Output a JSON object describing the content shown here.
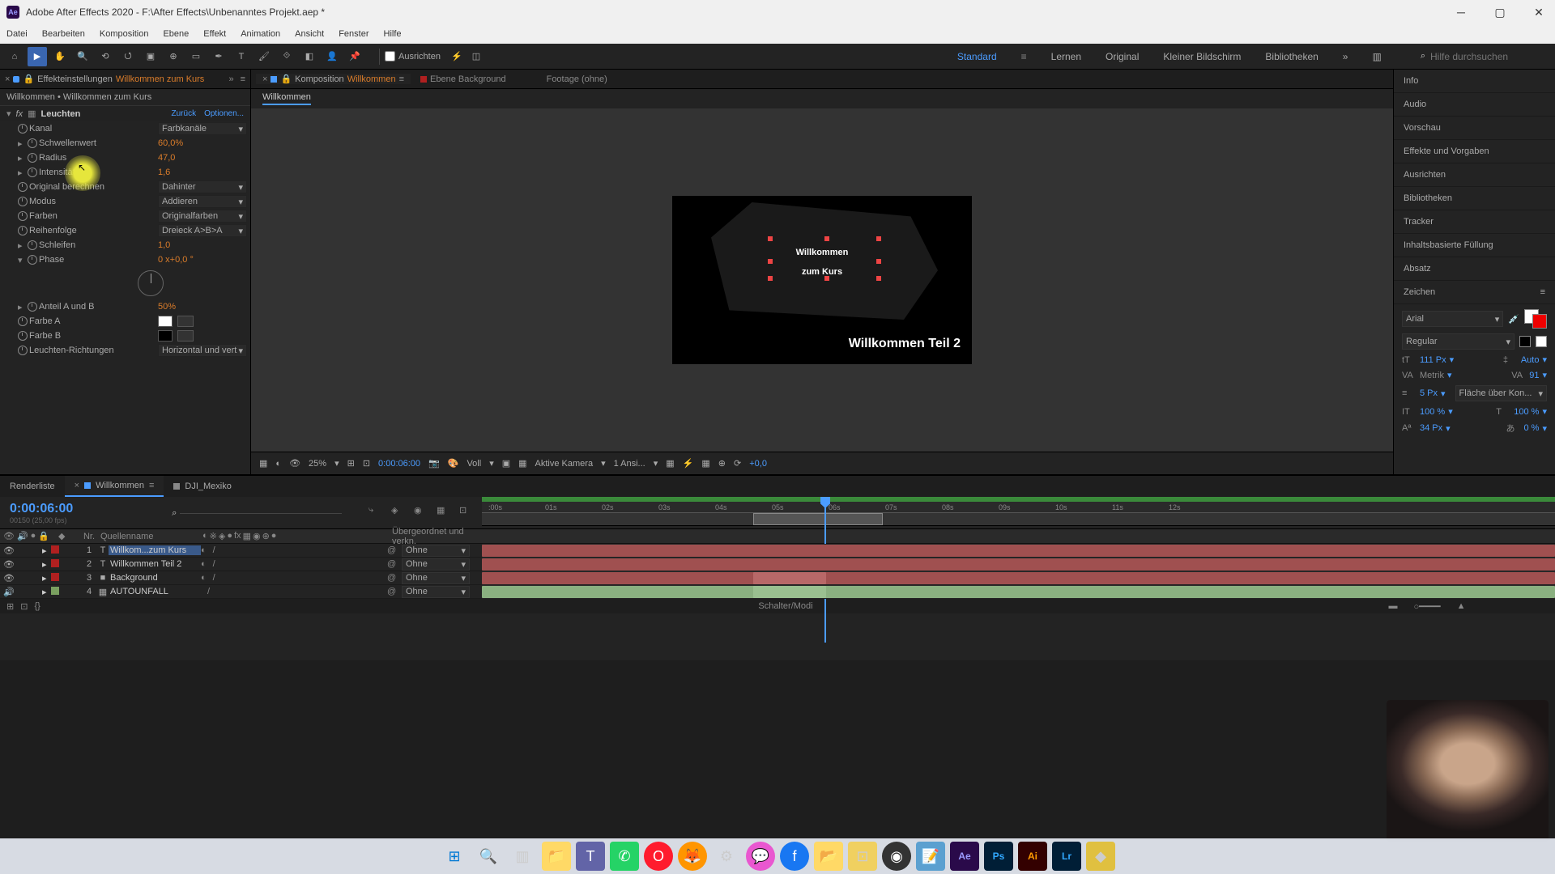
{
  "window": {
    "title": "Adobe After Effects 2020 - F:\\After Effects\\Unbenanntes Projekt.aep *",
    "app_badge": "Ae"
  },
  "menu": [
    "Datei",
    "Bearbeiten",
    "Komposition",
    "Ebene",
    "Effekt",
    "Animation",
    "Ansicht",
    "Fenster",
    "Hilfe"
  ],
  "toolbar": {
    "ausrichten_label": "Ausrichten",
    "search_placeholder": "Hilfe durchsuchen"
  },
  "workspaces": [
    "Standard",
    "Lernen",
    "Original",
    "Kleiner Bildschirm",
    "Bibliotheken"
  ],
  "effect_panel": {
    "tab_label": "Effekteinstellungen",
    "tab_target": "Willkommen zum Kurs",
    "breadcrumb": "Willkommen • Willkommen zum Kurs",
    "effect_name": "Leuchten",
    "reset_link": "Zurück",
    "options_link": "Optionen...",
    "props": {
      "kanal": {
        "label": "Kanal",
        "value": "Farbkanäle"
      },
      "schwellenwert": {
        "label": "Schwellenwert",
        "value": "60,0%"
      },
      "radius": {
        "label": "Radius",
        "value": "47,0"
      },
      "intensitaet": {
        "label": "Intensität",
        "value": "1,6"
      },
      "original": {
        "label": "Original berechnen",
        "value": "Dahinter"
      },
      "modus": {
        "label": "Modus",
        "value": "Addieren"
      },
      "farben": {
        "label": "Farben",
        "value": "Originalfarben"
      },
      "reihenfolge": {
        "label": "Reihenfolge",
        "value": "Dreieck A>B>A"
      },
      "schleifen": {
        "label": "Schleifen",
        "value": "1,0"
      },
      "phase": {
        "label": "Phase",
        "value": "0 x+0,0 °"
      },
      "anteil": {
        "label": "Anteil A und B",
        "value": "50%"
      },
      "farbe_a": {
        "label": "Farbe A"
      },
      "farbe_b": {
        "label": "Farbe B"
      },
      "richtungen": {
        "label": "Leuchten-Richtungen",
        "value": "Horizontal und vert"
      }
    }
  },
  "viewer": {
    "tabs": {
      "komposition": "Komposition",
      "komposition_target": "Willkommen",
      "ebene": "Ebene Background",
      "footage": "Footage (ohne)"
    },
    "subnav": "Willkommen",
    "text_main_l1": "Willkommen",
    "text_main_l2": "zum Kurs",
    "text_sub": "Willkommen Teil 2",
    "footer": {
      "zoom": "25%",
      "timecode": "0:00:06:00",
      "resolution": "Voll",
      "camera": "Aktive Kamera",
      "views": "1 Ansi...",
      "exposure": "+0,0"
    }
  },
  "right_panels": [
    "Info",
    "Audio",
    "Vorschau",
    "Effekte und Vorgaben",
    "Ausrichten",
    "Bibliotheken",
    "Tracker",
    "Inhaltsbasierte Füllung",
    "Absatz"
  ],
  "character": {
    "title": "Zeichen",
    "font": "Arial",
    "style": "Regular",
    "size": "111 Px",
    "leading": "Auto",
    "kerning": "Metrik",
    "tracking": "91",
    "stroke": "5 Px",
    "stroke_opt": "Fläche über Kon...",
    "vscale": "100 %",
    "hscale": "100 %",
    "baseline": "34 Px",
    "tsume": "0 %"
  },
  "timeline": {
    "tabs": {
      "render": "Renderliste",
      "comp1": "Willkommen",
      "comp2": "DJI_Mexiko"
    },
    "timecode": "0:00:06:00",
    "fps": "00150 (25,00 fps)",
    "col_nr": "Nr.",
    "col_name": "Quellenname",
    "col_parent": "Übergeordnet und verkn.",
    "none": "Ohne",
    "ruler": [
      ":00s",
      "01s",
      "02s",
      "03s",
      "04s",
      "05s",
      "06s",
      "07s",
      "08s",
      "09s",
      "10s",
      "11s",
      "12s"
    ],
    "layers": [
      {
        "nr": "1",
        "name": "Willkom...zum Kurs",
        "type": "T",
        "color": "#b02020",
        "selected": true
      },
      {
        "nr": "2",
        "name": "Willkommen Teil 2",
        "type": "T",
        "color": "#b02020",
        "selected": false
      },
      {
        "nr": "3",
        "name": "Background",
        "type": "■",
        "color": "#b02020",
        "selected": false
      },
      {
        "nr": "4",
        "name": "AUTOUNFALL",
        "type": "▦",
        "color": "#7aa060",
        "selected": false
      }
    ],
    "footer": "Schalter/Modi"
  }
}
